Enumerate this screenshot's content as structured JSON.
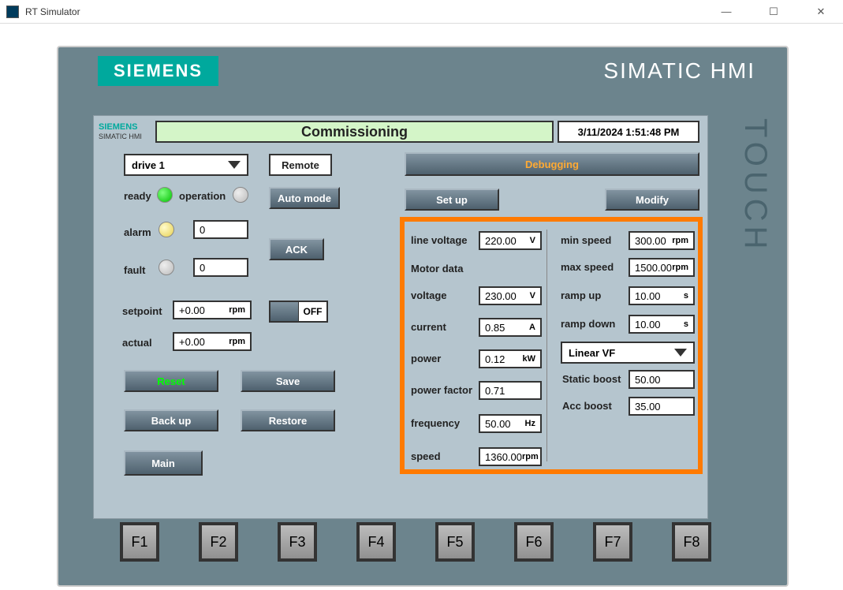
{
  "window": {
    "title": "RT Simulator"
  },
  "header": {
    "logo": "SIEMENS",
    "brand": "SIMATIC HMI",
    "touch": "TOUCH",
    "sublogo": "SIEMENS",
    "subsub": "SIMATIC HMI",
    "page_title": "Commissioning",
    "datetime": "3/11/2024 1:51:48 PM"
  },
  "drive": {
    "selected": "drive 1",
    "remote_btn": "Remote",
    "automode_btn": "Auto mode",
    "ack_btn": "ACK"
  },
  "status": {
    "ready_label": "ready",
    "operation_label": "operation",
    "alarm_label": "alarm",
    "alarm_value": "0",
    "fault_label": "fault",
    "fault_value": "0"
  },
  "speed": {
    "setpoint_label": "setpoint",
    "setpoint_value": "+0.00",
    "setpoint_unit": "rpm",
    "actual_label": "actual",
    "actual_value": "+0.00",
    "actual_unit": "rpm",
    "off_state": "OFF"
  },
  "buttons": {
    "reset": "Reset",
    "save": "Save",
    "backup": "Back up",
    "restore": "Restore",
    "main": "Main"
  },
  "right": {
    "debugging": "Debugging",
    "setup": "Set up",
    "modify": "Modify"
  },
  "motor": {
    "line_voltage_label": "line voltage",
    "line_voltage_value": "220.00",
    "line_voltage_unit": "V",
    "motor_data_label": "Motor data",
    "voltage_label": "voltage",
    "voltage_value": "230.00",
    "voltage_unit": "V",
    "current_label": "current",
    "current_value": "0.85",
    "current_unit": "A",
    "power_label": "power",
    "power_value": "0.12",
    "power_unit": "kW",
    "pf_label": "power factor",
    "pf_value": "0.71",
    "freq_label": "frequency",
    "freq_value": "50.00",
    "freq_unit": "Hz",
    "speed_label": "speed",
    "speed_value": "1360.00",
    "speed_unit": "rpm"
  },
  "limits": {
    "min_speed_label": "min speed",
    "min_speed_value": "300.00",
    "min_speed_unit": "rpm",
    "max_speed_label": "max speed",
    "max_speed_value": "1500.00",
    "max_speed_unit": "rpm",
    "rampup_label": "ramp up",
    "rampup_value": "10.00",
    "rampup_unit": "s",
    "rampdown_label": "ramp down",
    "rampdown_value": "10.00",
    "rampdown_unit": "s",
    "vf_mode": "Linear VF",
    "static_boost_label": "Static boost",
    "static_boost_value": "50.00",
    "acc_boost_label": "Acc boost",
    "acc_boost_value": "35.00"
  },
  "fkeys": [
    "F1",
    "F2",
    "F3",
    "F4",
    "F5",
    "F6",
    "F7",
    "F8"
  ]
}
